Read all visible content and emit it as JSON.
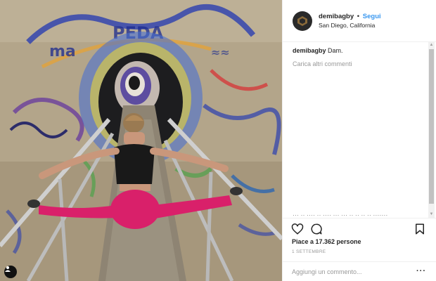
{
  "post": {
    "username": "demibagby",
    "separator": "•",
    "follow_label": "Segui",
    "location": "San Diego, California",
    "caption_user": "demibagby",
    "caption_text": "Dam.",
    "load_more_label": "Carica altri commenti",
    "cut_comment_text": "··· ·· ···· ·· ···· ··· ··· ·· ·· ·· ·· ·······",
    "likes_text": "Piace a 17.362 persone",
    "date_text": "1 SETTEMBRE",
    "comment_placeholder": "Aggiungi un commento...",
    "more_options_label": "···"
  },
  "icons": {
    "like": "heart-icon",
    "comment": "comment-bubble-icon",
    "save": "bookmark-icon",
    "tag": "user-tag-icon",
    "scroll_up": "▲",
    "scroll_down": "▼"
  },
  "colors": {
    "accent": "#3897f0",
    "text": "#262626",
    "muted": "#999999",
    "leggings": "#d9206a"
  }
}
